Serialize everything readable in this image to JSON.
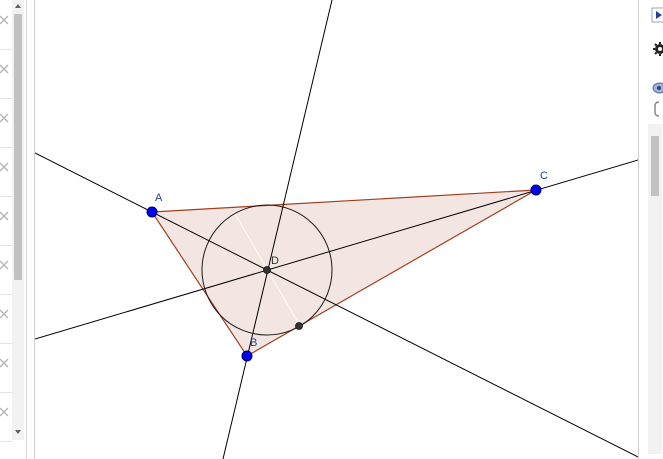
{
  "algebra": {
    "rows": [
      "row-1",
      "row-2",
      "row-3",
      "row-4",
      "row-5",
      "row-6",
      "row-7",
      "row-8",
      "row-9"
    ]
  },
  "graphics": {
    "points": {
      "A": {
        "label": "A"
      },
      "B": {
        "label": "B"
      },
      "C": {
        "label": "C"
      },
      "D": {
        "label": "D"
      }
    }
  },
  "icons": {
    "row_delete": "close-icon",
    "scroll_up": "chevron-up-icon",
    "scroll_down": "chevron-down-icon",
    "style_bar_toggle": "play-icon",
    "settings": "gear-icon",
    "visibility": "eye-icon"
  },
  "colors": {
    "point_free": "#0000ee",
    "point_dependent": "#333333",
    "polygon_fill": "#f3e6e2",
    "polygon_edge": "#a0401e",
    "line": "#000000",
    "label_free": "#1a3eaa"
  }
}
